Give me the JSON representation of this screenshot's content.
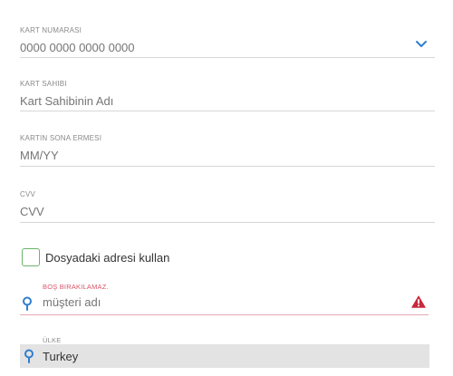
{
  "card_number": {
    "label": "KART NUMARASI",
    "placeholder": "0000 0000 0000 0000",
    "value": ""
  },
  "card_holder": {
    "label": "KART SAHIBI",
    "placeholder": "Kart Sahibinin Adı",
    "value": ""
  },
  "card_expiry": {
    "label": "KARTIN SONA ERMESI",
    "placeholder": "MM/YY",
    "value": ""
  },
  "card_cvv": {
    "label": "CVV",
    "placeholder": "CVV",
    "value": ""
  },
  "use_address": {
    "label": "Dosyadaki adresi kullan",
    "checked": false
  },
  "customer_name": {
    "error_label": "BOŞ BIRAKILAMAZ.",
    "placeholder": "müşteri adı",
    "value": "",
    "icon": "location-pin-icon",
    "error_icon": "warning-triangle-icon"
  },
  "country": {
    "label": "ÜLKE",
    "value": "Turkey",
    "icon": "location-pin-icon"
  },
  "colors": {
    "accent_blue": "#2f7fd0",
    "error_red": "#d9576a",
    "check_green": "#6bb36b"
  }
}
